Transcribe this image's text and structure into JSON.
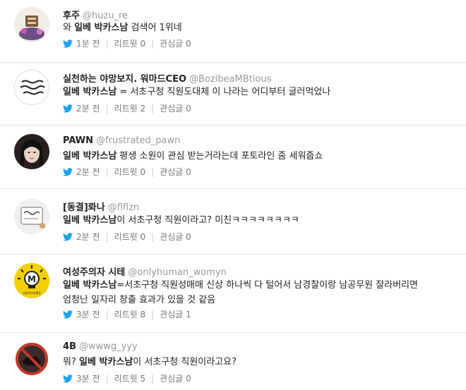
{
  "tweets": [
    {
      "name": "후주",
      "handle": "@huzu_re",
      "kw": "",
      "pre": "와 ",
      "kw_text": "일베 박카스남",
      "post": " 검색어 1위네",
      "line2": "",
      "time": "1분 전",
      "retweet": "리트윗 0",
      "fav": "관심글 0"
    },
    {
      "name": "실천하는 야망보지. 워마드CEO",
      "handle": "@BozibeaMBtious",
      "pre": "",
      "kw_text": "일베 박카스남",
      "post": " = 서초구청 직원도대체 이 나라는 어디부터 글러먹었나",
      "line2": "",
      "time": "2분 전",
      "retweet": "리트윗 2",
      "fav": "관심글 0"
    },
    {
      "name": "PAWN",
      "handle": "@frustrated_pawn",
      "pre": "",
      "kw_text": "일베 박카스남",
      "post": " 평생 소원이 관심 받는거라는데 포토라인 좀 세워줍쇼",
      "line2": "",
      "time": "2분 전",
      "retweet": "리트윗 0",
      "fav": "관심글 0"
    },
    {
      "name": "[동결]롸나",
      "handle": "@flflzn",
      "pre": "",
      "kw_text": "일베 박카스남",
      "post": "이 서초구청 직원이라고? 미친ㅋㅋㅋㅋㅋㅋㅋㅋ",
      "line2": "",
      "time": "2분 전",
      "retweet": "리트윗 0",
      "fav": "관심글 0"
    },
    {
      "name": "여성주의자 시테",
      "handle": "@onlyhuman_womyn",
      "pre": "",
      "kw_text": "일베 박카스남",
      "post": "=서초구청 직원성매매 신상 하나씩 다 털어서 남경찰이랑 남공무원 잘라버리면",
      "line2": "엄청난 일자리 창출 효과가 있을 것 같음",
      "time": "3분 전",
      "retweet": "리트윗 8",
      "fav": "관심글 1"
    },
    {
      "name": "4B",
      "handle": "@wwwg_yyy",
      "pre": "뭐? ",
      "kw_text": "일베 박카스남",
      "post": "이 서초구청 직원이라고요?",
      "line2": "",
      "time": "3분 전",
      "retweet": "리트윗 5",
      "fav": "관심글 0"
    }
  ],
  "avatar_text": {
    "t5": "여성주의자행동"
  },
  "colors": {
    "bird": "#1da1f2",
    "handle": "#999999",
    "meta": "#777777"
  }
}
